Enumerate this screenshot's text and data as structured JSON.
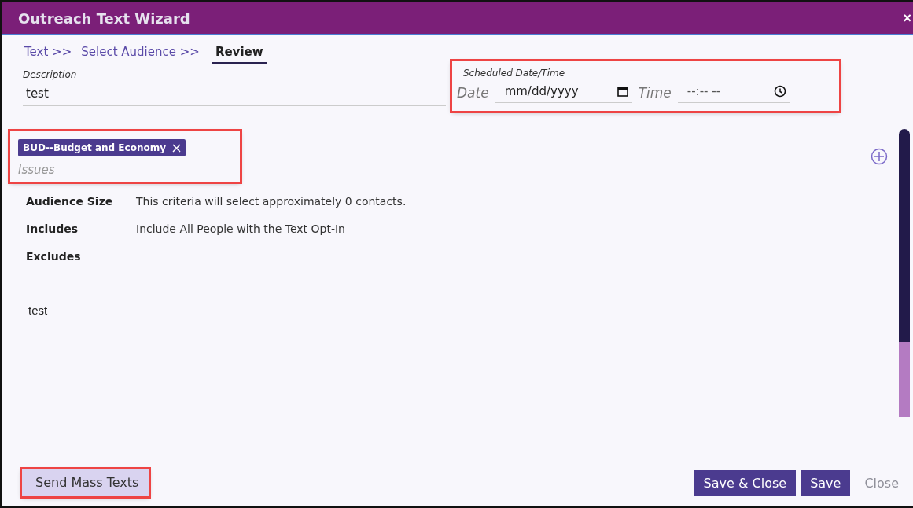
{
  "window": {
    "title": "Outreach Text Wizard",
    "close": "×"
  },
  "steps": [
    {
      "label": "Text >>",
      "selected": false
    },
    {
      "label": "Select Audience >>",
      "selected": false
    },
    {
      "label": "Review",
      "selected": true
    }
  ],
  "description": {
    "label": "Description",
    "value": "test"
  },
  "schedule": {
    "label": "Scheduled Date/Time",
    "date_label": "Date",
    "date_placeholder": "mm/dd/yyyy",
    "time_label": "Time",
    "time_placeholder": "--:-- --",
    "highlighted": true
  },
  "issues": {
    "tags": [
      {
        "label": "BUD--Budget and Economy"
      }
    ],
    "placeholder": "Issues",
    "highlighted": true
  },
  "summary": [
    {
      "label": "Audience Size",
      "value": "This criteria will select approximately 0 contacts."
    },
    {
      "label": "Includes",
      "value": "Include All People with the Text Opt-In"
    },
    {
      "label": "Excludes"
    }
  ],
  "message": "test",
  "buttons": [
    {
      "label": "Send Mass Texts",
      "kind": "secondary",
      "disabled": false,
      "highlighted": true
    },
    {
      "label": "Save & Close",
      "kind": "primary",
      "disabled": false,
      "highlighted": false
    },
    {
      "label": "Save",
      "kind": "primary",
      "disabled": false,
      "highlighted": false
    },
    {
      "label": "Close",
      "kind": "primary",
      "disabled": true,
      "highlighted": false
    }
  ]
}
